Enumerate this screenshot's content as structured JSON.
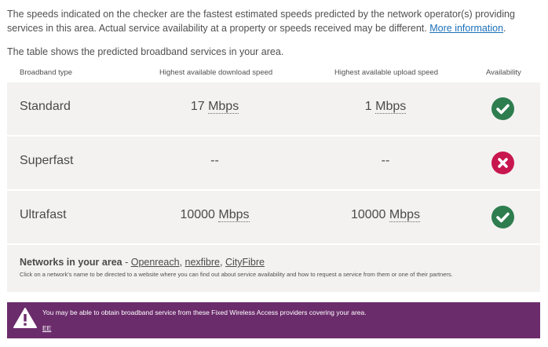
{
  "intro": {
    "text": "The speeds indicated on the checker are the fastest estimated speeds predicted by the network operator(s) providing services in this area. Actual service availability at a property or speeds received may be different.",
    "more_link": "More information",
    "more_suffix": "."
  },
  "lead": "The table shows the predicted broadband services in your area.",
  "table": {
    "headers": {
      "type": "Broadband type",
      "download": "Highest available download speed",
      "upload": "Highest available upload speed",
      "availability": "Availability"
    },
    "rows": [
      {
        "type": "Standard",
        "download_value": "17",
        "download_unit": "Mbps",
        "upload_value": "1",
        "upload_unit": "Mbps",
        "available": true,
        "icon": "check-circle-icon"
      },
      {
        "type": "Superfast",
        "download_value": "--",
        "download_unit": "",
        "upload_value": "--",
        "upload_unit": "",
        "available": false,
        "icon": "cross-circle-icon"
      },
      {
        "type": "Ultrafast",
        "download_value": "10000",
        "download_unit": "Mbps",
        "upload_value": "10000",
        "upload_unit": "Mbps",
        "available": true,
        "icon": "check-circle-icon"
      }
    ],
    "colors": {
      "available": "#2e7d4f",
      "unavailable": "#c8174f",
      "row_bg": "#f3f2f1"
    }
  },
  "networks": {
    "label": "Networks in your area",
    "separator": " - ",
    "providers": [
      "Openreach",
      "nexfibre",
      "CityFibre"
    ],
    "note": "Click on a network's name to be directed to a website where you can find out about service availability and how to request a service from them or one of their partners."
  },
  "fwa": {
    "icon": "warning-icon",
    "text": "You may be able to obtain broadband service from these Fixed Wireless Access providers covering your area.",
    "link": "EE",
    "color": "#6b2c6b"
  }
}
